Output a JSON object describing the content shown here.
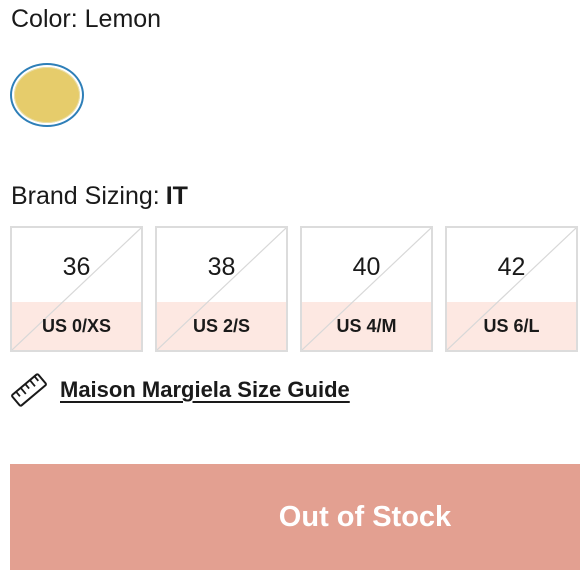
{
  "color": {
    "label_prefix": "Color:",
    "value": "Lemon",
    "swatch_hex": "#e6cc6b",
    "ring_hex": "#2e7fb8"
  },
  "sizing": {
    "label": "Brand Sizing:",
    "system": "IT",
    "options": [
      {
        "it": "36",
        "us": "US 0/XS",
        "available": false
      },
      {
        "it": "38",
        "us": "US 2/S",
        "available": false
      },
      {
        "it": "40",
        "us": "US 4/M",
        "available": false
      },
      {
        "it": "42",
        "us": "US 6/L",
        "available": false
      }
    ]
  },
  "size_guide": {
    "icon": "ruler-icon",
    "label": "Maison Margiela Size Guide"
  },
  "cta": {
    "label": "Out of Stock",
    "bg_hex": "#e3a091"
  }
}
